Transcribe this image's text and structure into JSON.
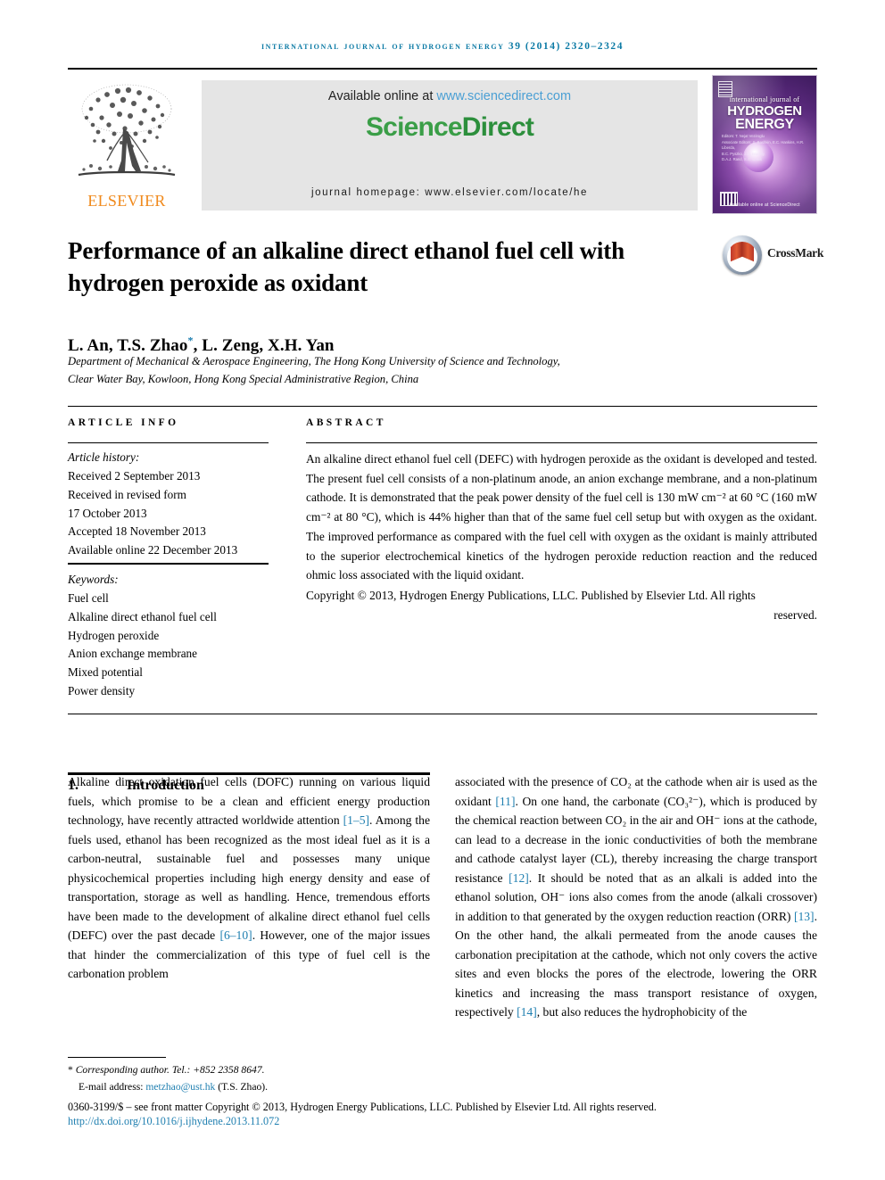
{
  "running_head": "International Journal of Hydrogen Energy 39 (2014) 2320–2324",
  "masthead": {
    "publisher": "Elsevier",
    "available_prefix": "Available online at ",
    "available_url": "www.sciencedirect.com",
    "sciencedirect_part1": "Science",
    "sciencedirect_part2": "Direct",
    "journal_homepage": "journal homepage: www.elsevier.com/locate/he",
    "cover": {
      "line_small": "international journal of",
      "line1": "HYDROGEN",
      "line2": "ENERGY",
      "editors": "Editors:  T. Nejat Veziroglu\nAssociate Editors:  S. Bashkin, E.C. Hankins, H.R. Liberda,\nB.C. Pyszko, J.M. Blachly,\nD.A.J. Rand, S.G. Chalk",
      "footer": "Available online at ScienceDirect"
    }
  },
  "article": {
    "title": "Performance of an alkaline direct ethanol fuel cell with hydrogen peroxide as oxidant",
    "crossmark_label": "CrossMark",
    "authors": "L. An, T.S. Zhao*, L. Zeng, X.H. Yan",
    "affiliation_line1": "Department of Mechanical & Aerospace Engineering, The Hong Kong University of Science and Technology,",
    "affiliation_line2": "Clear Water Bay, Kowloon, Hong Kong Special Administrative Region, China"
  },
  "info": {
    "heading": "ARTICLE INFO",
    "history_label": "Article history:",
    "history": [
      "Received 2 September 2013",
      "Received in revised form",
      "17 October 2013",
      "Accepted 18 November 2013",
      "Available online 22 December 2013"
    ],
    "keywords_label": "Keywords:",
    "keywords": [
      "Fuel cell",
      "Alkaline direct ethanol fuel cell",
      "Hydrogen peroxide",
      "Anion exchange membrane",
      "Mixed potential",
      "Power density"
    ]
  },
  "abstract": {
    "heading": "ABSTRACT",
    "body": "An alkaline direct ethanol fuel cell (DEFC) with hydrogen peroxide as the oxidant is developed and tested. The present fuel cell consists of a non-platinum anode, an anion exchange membrane, and a non-platinum cathode. It is demonstrated that the peak power density of the fuel cell is 130 mW cm⁻² at 60 °C (160 mW cm⁻² at 80 °C), which is 44% higher than that of the same fuel cell setup but with oxygen as the oxidant. The improved performance as compared with the fuel cell with oxygen as the oxidant is mainly attributed to the superior electrochemical kinetics of the hydrogen peroxide reduction reaction and the reduced ohmic loss associated with the liquid oxidant.",
    "copyright": "Copyright © 2013, Hydrogen Energy Publications, LLC. Published by Elsevier Ltd. All rights",
    "copyright_last": "reserved."
  },
  "body": {
    "section_number": "1.",
    "section_title": "Introduction",
    "left_column": "Alkaline direct oxidation fuel cells (DOFC) running on various liquid fuels, which promise to be a clean and efficient energy production technology, have recently attracted worldwide attention [1–5]. Among the fuels used, ethanol has been recognized as the most ideal fuel as it is a carbon-neutral, sustainable fuel and possesses many unique physicochemical properties including high energy density and ease of transportation, storage as well as handling. Hence, tremendous efforts have been made to the development of alkaline direct ethanol fuel cells (DEFC) over the past decade [6–10]. However, one of the major issues that hinder the commercialization of this type of fuel cell is the carbonation problem",
    "right_column": "associated with the presence of CO₂ at the cathode when air is used as the oxidant [11]. On one hand, the carbonate (CO₃²⁻), which is produced by the chemical reaction between CO₂ in the air and OH⁻ ions at the cathode, can lead to a decrease in the ionic conductivities of both the membrane and cathode catalyst layer (CL), thereby increasing the charge transport resistance [12]. It should be noted that as an alkali is added into the ethanol solution, OH⁻ ions also comes from the anode (alkali crossover) in addition to that generated by the oxygen reduction reaction (ORR) [13]. On the other hand, the alkali permeated from the anode causes the carbonation precipitation at the cathode, which not only covers the active sites and even blocks the pores of the electrode, lowering the ORR kinetics and increasing the mass transport resistance of oxygen, respectively [14], but also reduces the hydrophobicity of the"
  },
  "footer": {
    "corresponding": "Corresponding author. Tel.: +852 2358 8647.",
    "email_label": "E-mail address: ",
    "email": "metzhao@ust.hk",
    "email_suffix": " (T.S. Zhao).",
    "issn_line": "0360-3199/$ – see front matter Copyright © 2013, Hydrogen Energy Publications, LLC. Published by Elsevier Ltd. All rights reserved.",
    "doi": "http://dx.doi.org/10.1016/j.ijhydene.2013.11.072"
  },
  "colors": {
    "link": "#1f7fb0",
    "running_head": "#0b7aa5",
    "elsevier_orange": "#f08a1d",
    "sciencedirect_green": "#3a9e47"
  }
}
